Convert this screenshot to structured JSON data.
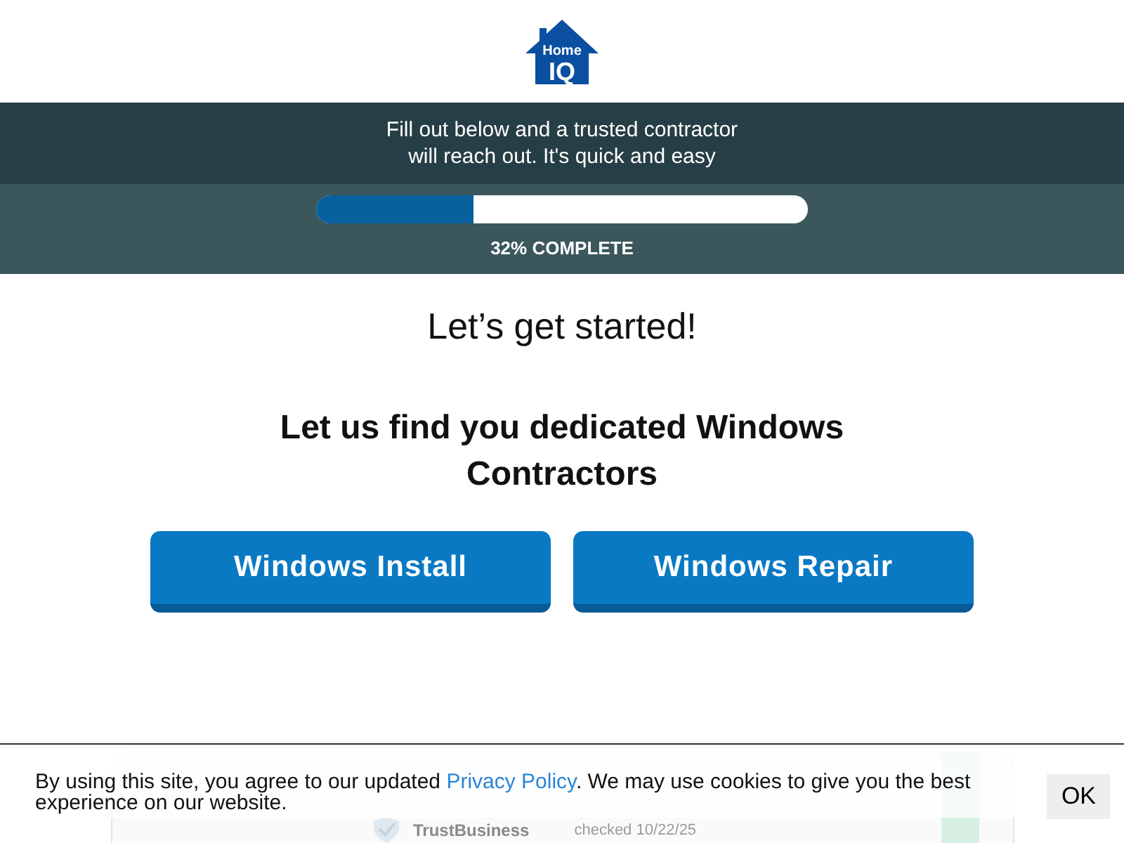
{
  "logo": {
    "line_1": "Home",
    "line_2": "IQ"
  },
  "intro": {
    "line_1": "Fill out below and a trusted contractor",
    "line_2": "will reach out. It's quick and easy"
  },
  "progress": {
    "level": 0.32,
    "label": "32% COMPLETE"
  },
  "greeting": "Let’s get started!",
  "heading": "Let us find you dedicated Windows Contractors",
  "options": [
    {
      "label": "Windows Install"
    },
    {
      "label": "Windows Repair"
    }
  ],
  "trust_badge": {
    "name": "TrustBusiness",
    "date": "checked 10/22/25"
  },
  "cookie_bar": {
    "text_before": "By using this site, you agree to our updated ",
    "link": "Privacy Policy",
    "text_after": ". We may use cookies to give you the best experience on our website.",
    "button": "OK"
  }
}
